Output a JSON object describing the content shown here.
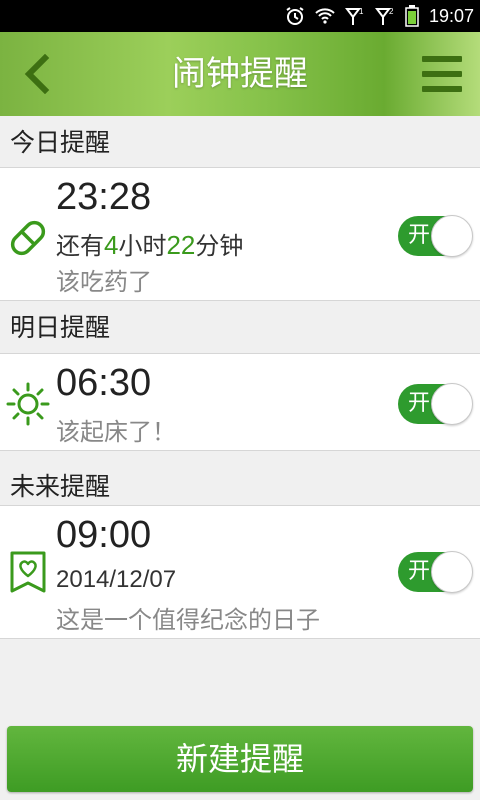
{
  "status_bar": {
    "time": "19:07"
  },
  "header": {
    "title": "闹钟提醒"
  },
  "sections": [
    {
      "title": "今日提醒",
      "alarm": {
        "icon": "pill-icon",
        "time": "23:28",
        "countdown": {
          "prefix": "还有",
          "hours": "4",
          "hour_unit": "小时",
          "minutes": "22",
          "minute_unit": "分钟"
        },
        "message": "该吃药了",
        "toggle_label": "开"
      }
    },
    {
      "title": "明日提醒",
      "alarm": {
        "icon": "sun-icon",
        "time": "06:30",
        "message": "该起床了！",
        "toggle_label": "开"
      }
    },
    {
      "title": "未来提醒",
      "alarm": {
        "icon": "heart-bookmark-icon",
        "time": "09:00",
        "date": "2014/12/07",
        "message": "这是一个值得纪念的日子",
        "toggle_label": "开"
      }
    }
  ],
  "new_button_label": "新建提醒",
  "colors": {
    "accent": "#3a9a1c",
    "toggle_on": "#2e9b2e"
  }
}
